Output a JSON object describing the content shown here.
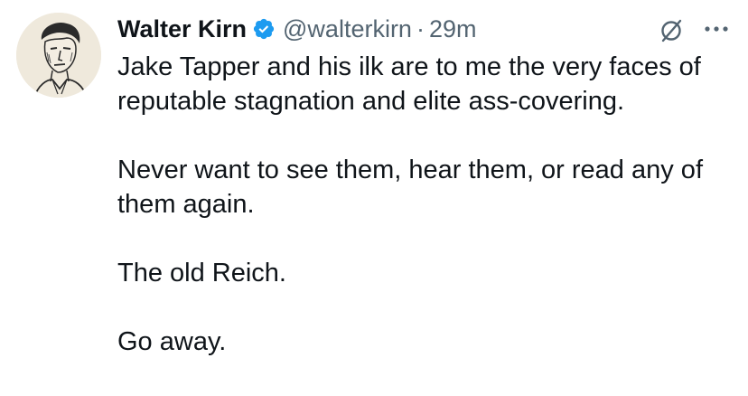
{
  "tweet": {
    "author": {
      "name": "Walter Kirn",
      "handle": "@walterkirn",
      "verified": true
    },
    "separator": "·",
    "time": "29m",
    "paragraphs": [
      "Jake Tapper and his ilk are to me the very faces of reputable stagnation and elite ass-covering.",
      "Never want to see them, hear them, or read any of them again.",
      "The old Reich.",
      "Go away."
    ]
  },
  "icons": {
    "verified": "verified-badge-icon",
    "grok": "grok-icon",
    "more": "more-icon"
  },
  "colors": {
    "text": "#0f1419",
    "secondary": "#536471",
    "verified_blue": "#1d9bf0",
    "background": "#ffffff"
  }
}
